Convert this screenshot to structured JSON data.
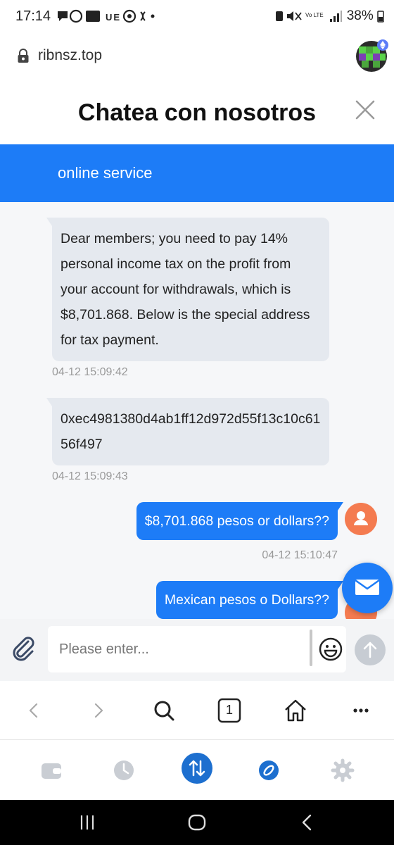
{
  "status_bar": {
    "time": "17:14",
    "notification_text": "UE",
    "indicators": "Vo LTE LTE+",
    "battery": "38%"
  },
  "browser": {
    "url": "ribnsz.top"
  },
  "chat": {
    "title": "Chatea con nosotros",
    "service_label": "online service",
    "messages": [
      {
        "direction": "incoming",
        "text": "Dear members; you need to pay 14% personal income tax on the profit from your account for withdrawals, which is $8,701.868. Below is the special address for tax payment.",
        "time": "04-12 15:09:42"
      },
      {
        "direction": "incoming",
        "text": "0xec4981380d4ab1ff12d972d55f13c10c6156f497",
        "time": "04-12 15:09:43"
      },
      {
        "direction": "outgoing",
        "text": "$8,701.868 pesos or dollars??",
        "time": "04-12 15:10:47"
      },
      {
        "direction": "outgoing",
        "text": "Mexican pesos o Dollars??",
        "time": ""
      }
    ],
    "composer": {
      "placeholder": "Please enter..."
    }
  },
  "browser_nav": {
    "tab_count": "1"
  },
  "colors": {
    "accent": "#1d7cf7",
    "incoming_bubble": "#e5e9ef",
    "user_avatar": "#f47b50",
    "active_tab": "#1d6fcf"
  }
}
